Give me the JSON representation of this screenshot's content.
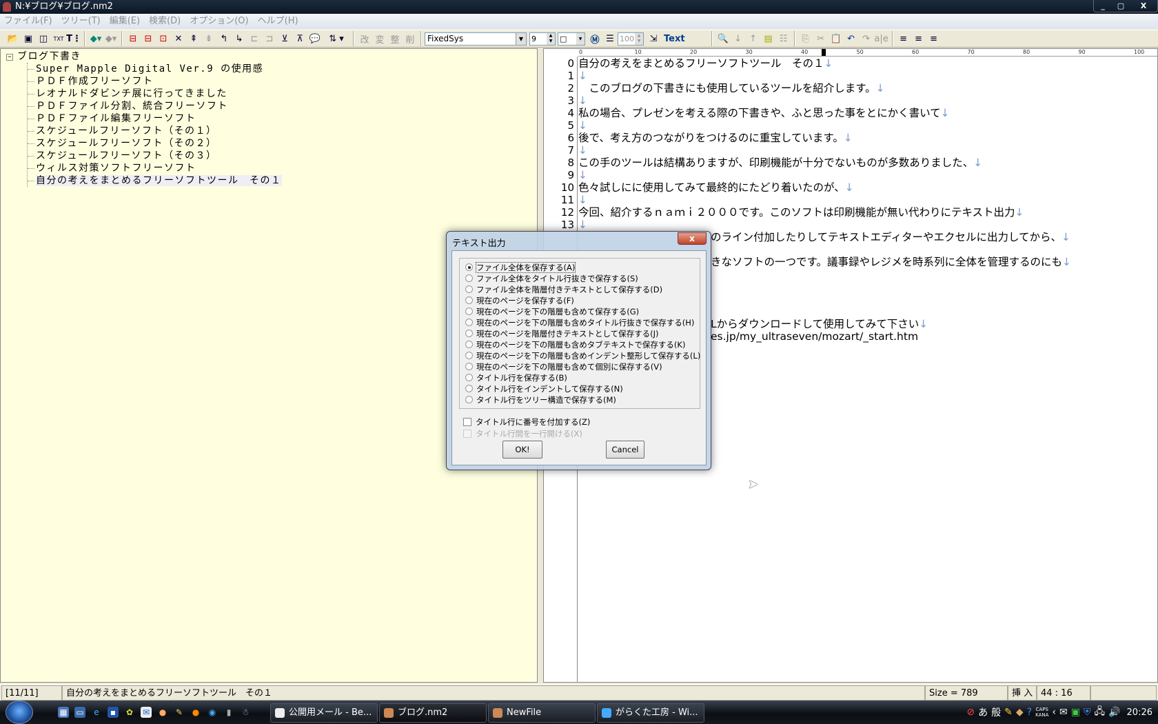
{
  "window": {
    "title": "N:¥ブログ¥ブログ.nm2",
    "controls": [
      "_",
      "▢",
      "X"
    ]
  },
  "menu": [
    "ファイル(F)",
    "ツリー(T)",
    "編集(E)",
    "検索(D)",
    "オプション(O)",
    "ヘルプ(H)"
  ],
  "toolbar": {
    "font": "FixedSys",
    "font_size": "9",
    "box_style": "□",
    "zoom": "100",
    "text_label": "Text",
    "icons_left": [
      "open-folder-icon",
      "save-icon",
      "layout-icon",
      "text-open-icon",
      "text-tree-icon"
    ],
    "icons_nav": [
      "back-icon",
      "forward-icon"
    ],
    "icons_tree": [
      "add-sibling-icon",
      "add-child-icon",
      "add-node-icon",
      "delete-icon",
      "move-up-icon",
      "move-down-icon",
      "level-up-icon",
      "level-down-icon",
      "collapse-icon",
      "expand-icon",
      "import-icon",
      "export-icon",
      "comment-icon",
      "sort-icon"
    ],
    "icons_kanji": [
      "改",
      "変",
      "整",
      "削"
    ],
    "icons_right": [
      "find-icon",
      "find-next-icon",
      "find-prev-icon",
      "outline-icon",
      "list-icon",
      "copy-icon",
      "cut-icon",
      "paste-icon",
      "undo-icon",
      "redo-icon",
      "spell-icon",
      "align-left-icon",
      "align-center-icon",
      "align-right-icon"
    ]
  },
  "tree": {
    "root": "ブログ下書き",
    "items": [
      "Super Mapple Digital Ver.9 の使用感",
      "ＰＤＦ作成フリーソフト",
      "レオナルドダビンチ展に行ってきました",
      "ＰＤＦファイル分割、統合フリーソフト",
      "ＰＤＦファイル編集フリーソフト",
      "スケジュールフリーソフト（その１）",
      "スケジュールフリーソフト（その２）",
      "スケジュールフリーソフト（その３）",
      "ウィルス対策ソフトフリーソフト",
      "自分の考えをまとめるフリーソフトツール　その１"
    ],
    "selected_index": 9
  },
  "ruler": [
    "0",
    "10",
    "20",
    "30",
    "40",
    "50",
    "60",
    "70",
    "80",
    "90",
    "100"
  ],
  "editor": {
    "lines": [
      {
        "n": "0",
        "t": "自分の考えをまとめるフリーソフトツール　その１",
        "eol": "↓"
      },
      {
        "n": "1",
        "t": "",
        "eol": "↓"
      },
      {
        "n": "2",
        "t": "　このブログの下書きにも使用しているツールを紹介します。",
        "eol": "↓"
      },
      {
        "n": "3",
        "t": "",
        "eol": "↓"
      },
      {
        "n": "4",
        "t": "私の場合、プレゼンを考える際の下書きや、ふと思った事をとにかく書いて",
        "eol": "↓"
      },
      {
        "n": "5",
        "t": "",
        "eol": "↓"
      },
      {
        "n": "6",
        "t": "後で、考え方のつながりをつけるのに重宝しています。",
        "eol": "↓"
      },
      {
        "n": "7",
        "t": "",
        "eol": "↓"
      },
      {
        "n": "8",
        "t": "この手のツールは結構ありますが、印刷機能が十分でないものが多数ありました、",
        "eol": "↓"
      },
      {
        "n": "9",
        "t": "",
        "eol": "↓"
      },
      {
        "n": "10",
        "t": "色々試しにに使用してみて最終的にたどり着いたのが、",
        "eol": "↓"
      },
      {
        "n": "11",
        "t": "",
        "eol": "↓"
      },
      {
        "n": "12",
        "t": "今回、紹介するｎａｍｉ２０００です。このソフトは印刷機能が無い代わりにテキスト出力",
        "eol": "↓"
      },
      {
        "n": "13",
        "t": "",
        "eol": "↓"
      }
    ],
    "partial_lines": [
      {
        "row": 14,
        "t": "のライン付加したりしてテキストエディターやエクセルに出力してから、",
        "eol": "↓"
      },
      {
        "row": 16,
        "t": "きなソフトの一つです。議事録やレジメを時系列に全体を管理するのにも",
        "eol": "↓"
      },
      {
        "row": 21,
        "t": "Lからダウンロードして使用してみて下さい",
        "eol": "↓"
      },
      {
        "row": 22,
        "t": "es.jp/my_ultraseven/mozart/_start.htm",
        "eol": ""
      }
    ]
  },
  "dialog": {
    "title": "テキスト出力",
    "close": "x",
    "options": [
      "ファイル全体を保存する(A)",
      "ファイル全体をタイトル行抜きで保存する(S)",
      "ファイル全体を階層付きテキストとして保存する(D)",
      "現在のページを保存する(F)",
      "現在のページを下の階層も含めて保存する(G)",
      "現在のページを下の階層も含めタイトル行抜きで保存する(H)",
      "現在のページを階層付きテキストとして保存する(J)",
      "現在のページを下の階層も含めタブテキストで保存する(K)",
      "現在のページを下の階層も含めインデント整形して保存する(L)",
      "現在のページを下の階層も含めて個別に保存する(V)",
      "タイトル行を保存する(B)",
      "タイトル行をインデントして保存する(N)",
      "タイトル行をツリー構造で保存する(M)"
    ],
    "selected_option": 0,
    "checkbox_number": {
      "label": "タイトル行に番号を付加する(Z)",
      "checked": false
    },
    "checkbox_blank": {
      "label": "タイトル行間を一行開ける(X)",
      "checked": false,
      "disabled": true
    },
    "ok": "OK!",
    "cancel": "Cancel"
  },
  "status": {
    "page": "[11/11]",
    "title": "自分の考えをまとめるフリーソフトツール　その１",
    "size": "Size = 789",
    "mode": "挿 入",
    "pos": "44 : 16"
  },
  "taskbar": {
    "buttons": [
      {
        "label": "公開用メール - Be...",
        "icon": "mail-icon"
      },
      {
        "label": "ブログ.nm2",
        "icon": "nami-icon",
        "active": true
      },
      {
        "label": "NewFile",
        "icon": "nami-icon"
      },
      {
        "label": "がらくた工房 - Wi...",
        "icon": "ie-icon"
      }
    ],
    "tray": {
      "ime_mode": "あ",
      "ime_conv": "般",
      "caps": "CAPS",
      "kana": "KANA",
      "clock": "20:26"
    }
  }
}
